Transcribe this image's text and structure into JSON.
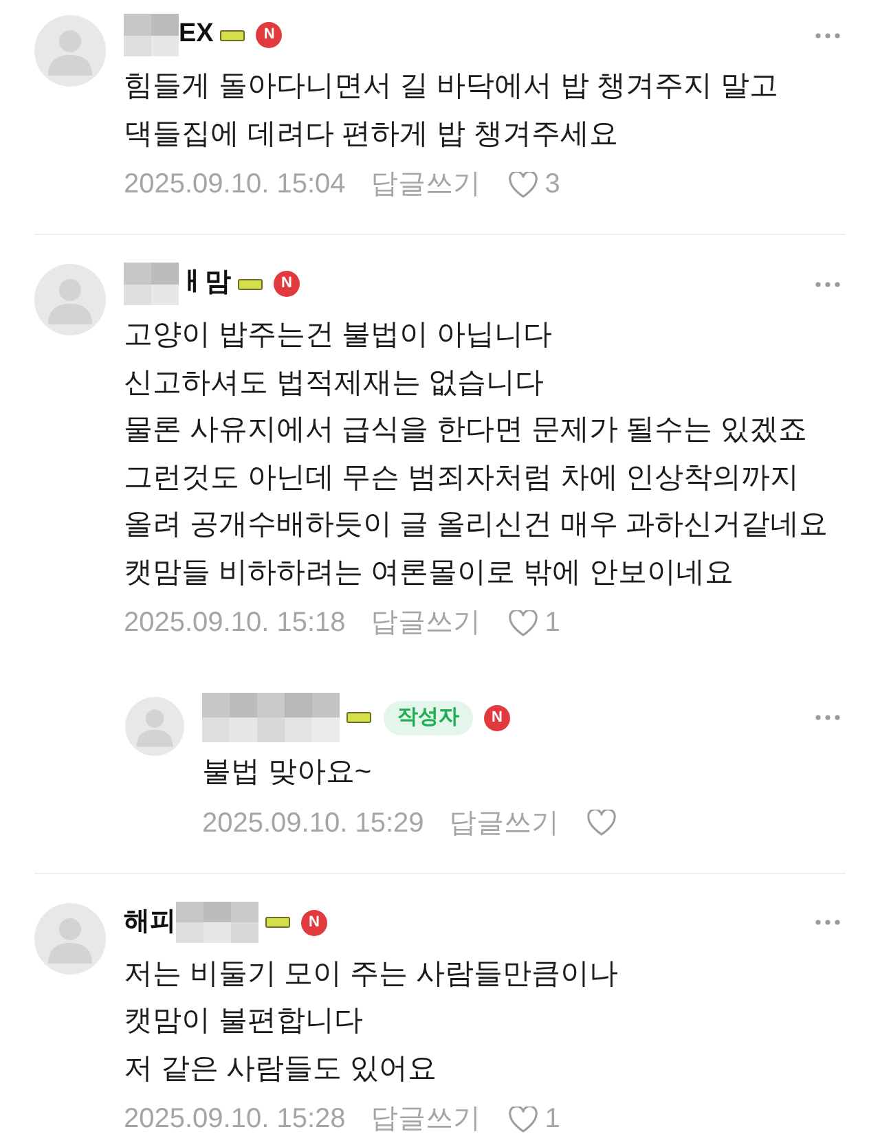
{
  "comments": [
    {
      "author_parts": [
        {
          "kind": "masked"
        },
        {
          "kind": "text",
          "text": "EX"
        }
      ],
      "badge": "N",
      "text": "힘들게 돌아다니면서 길 바닥에서 밥 챙겨주지 말고\n댁들집에 데려다 편하게 밥 챙겨주세요",
      "date": "2025.09.10. 15:04",
      "reply_label": "답글쓰기",
      "likes": "3"
    },
    {
      "author_parts": [
        {
          "kind": "masked"
        },
        {
          "kind": "text",
          "text": "ㅐ맘"
        }
      ],
      "badge": "N",
      "text": "고양이 밥주는건 불법이 아닙니다\n신고하셔도 법적제재는 없습니다\n물론 사유지에서 급식을 한다면 문제가 될수는 있겠죠\n그런것도 아닌데 무슨 범죄자처럼 차에 인상착의까지\n올려 공개수배하듯이 글 올리신건 매우 과하신거같네요\n캣맘들 비하하려는 여론몰이로 밖에 안보이네요",
      "date": "2025.09.10. 15:18",
      "reply_label": "답글쓰기",
      "likes": "1",
      "children": [
        {
          "author_parts": [
            {
              "kind": "masked"
            }
          ],
          "role_badge": "작성자",
          "badge": "N",
          "text": "불법 맞아요~",
          "date": "2025.09.10. 15:29",
          "reply_label": "답글쓰기"
        }
      ]
    },
    {
      "author_parts": [
        {
          "kind": "text",
          "text": "해피"
        },
        {
          "kind": "masked"
        }
      ],
      "badge": "N",
      "text": "저는 비둘기 모이 주는 사람들만큼이나\n캣맘이 불편합니다\n저 같은 사람들도 있어요",
      "date": "2025.09.10. 15:28",
      "reply_label": "답글쓰기",
      "likes": "1"
    }
  ]
}
